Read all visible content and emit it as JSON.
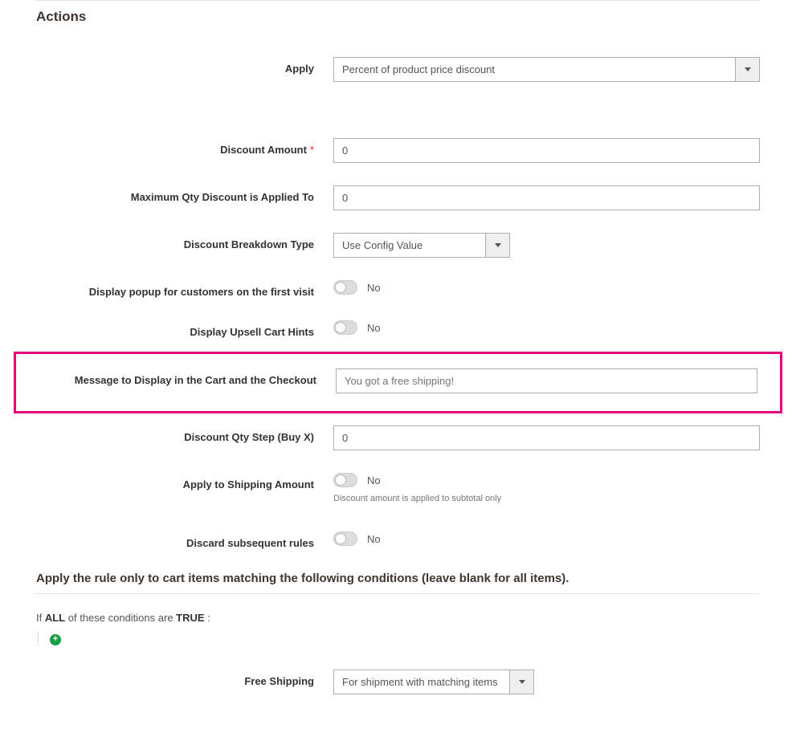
{
  "section": {
    "title": "Actions"
  },
  "fields": {
    "apply": {
      "label": "Apply",
      "value": "Percent of product price discount"
    },
    "discount_amount": {
      "label": "Discount Amount",
      "value": "0"
    },
    "max_qty": {
      "label": "Maximum Qty Discount is Applied To",
      "value": "0"
    },
    "breakdown": {
      "label": "Discount Breakdown Type",
      "value": "Use Config Value"
    },
    "popup_first_visit": {
      "label": "Display popup for customers on the first visit",
      "state": "No"
    },
    "upsell_hints": {
      "label": "Display Upsell Cart Hints",
      "state": "No"
    },
    "cart_message": {
      "label": "Message to Display in the Cart and the Checkout",
      "placeholder": "You got a free shipping!"
    },
    "qty_step": {
      "label": "Discount Qty Step (Buy X)",
      "value": "0"
    },
    "apply_to_shipping": {
      "label": "Apply to Shipping Amount",
      "state": "No",
      "hint": "Discount amount is applied to subtotal only"
    },
    "discard_rules": {
      "label": "Discard subsequent rules",
      "state": "No"
    },
    "free_shipping": {
      "label": "Free Shipping",
      "value": "For shipment with matching items"
    }
  },
  "conditions": {
    "heading": "Apply the rule only to cart items matching the following conditions (leave blank for all items).",
    "line_prefix": "If ",
    "kw_all": "ALL",
    "line_mid": "  of these conditions are ",
    "kw_true": "TRUE",
    "line_suffix": " :"
  }
}
